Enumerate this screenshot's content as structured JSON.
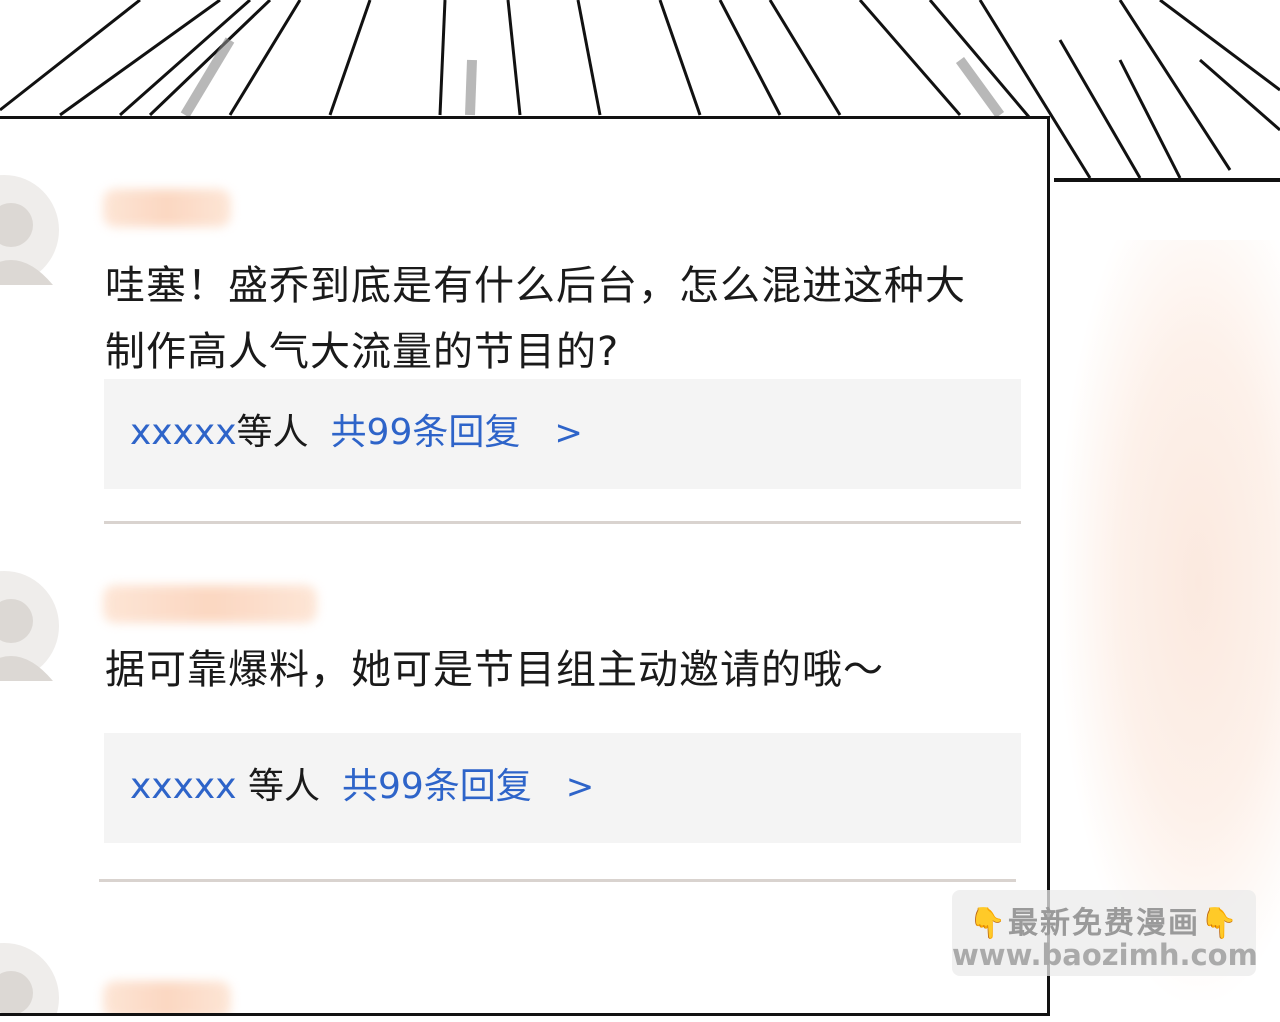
{
  "comments": [
    {
      "text": "哇塞！盛乔到底是有什么后台，怎么混进这种大制作高人气大流量的节目的?",
      "reply": {
        "users": "xxxxx",
        "suffix": "等人",
        "count": "共99条回复",
        "arrow": ">"
      }
    },
    {
      "text": "据可靠爆料，她可是节目组主动邀请的哦～",
      "reply": {
        "users": "xxxxx",
        "suffix": " 等人",
        "count": "共99条回复",
        "arrow": ">"
      }
    }
  ],
  "watermark": {
    "line1": "最新免费漫画",
    "line2": "www.baozimh.com",
    "icon": "pointing-down-hand-icon"
  },
  "colors": {
    "reply_blue": "#2e64c9",
    "reply_bg": "#f4f4f4",
    "username_blur": "#fbd3bb"
  }
}
